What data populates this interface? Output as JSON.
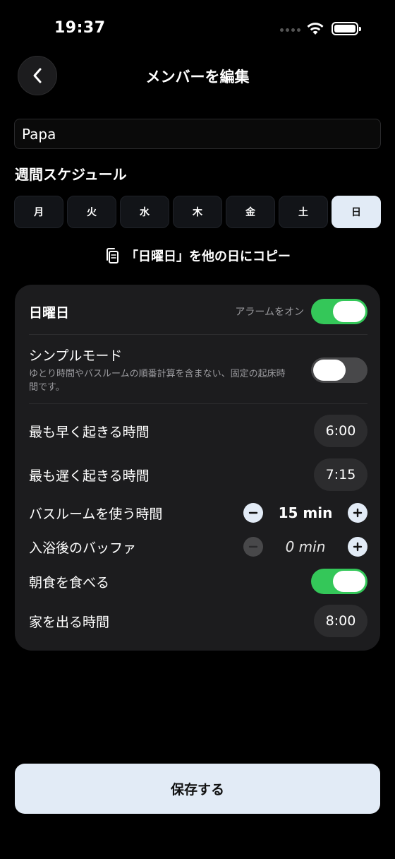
{
  "status": {
    "time": "19:37"
  },
  "nav": {
    "title": "メンバーを編集"
  },
  "member": {
    "name": "Papa"
  },
  "schedule": {
    "title": "週間スケジュール",
    "days": [
      "月",
      "火",
      "水",
      "木",
      "金",
      "土",
      "日"
    ],
    "selected_day": "日"
  },
  "copy": {
    "label": "「日曜日」を他の日にコピー"
  },
  "card": {
    "day_title": "日曜日",
    "alarm_label": "アラームをオン",
    "alarm_on": true,
    "simple_mode": {
      "label": "シンプルモード",
      "description": "ゆとり時間やバスルームの順番計算を含まない、固定の起床時間です。",
      "on": false
    },
    "earliest_wake": {
      "label": "最も早く起きる時間",
      "value": "6:00"
    },
    "latest_wake": {
      "label": "最も遅く起きる時間",
      "value": "7:15"
    },
    "bathroom": {
      "label": "バスルームを使う時間",
      "value": "15 min"
    },
    "buffer": {
      "label": "入浴後のバッファ",
      "value": "0 min"
    },
    "breakfast": {
      "label": "朝食を食べる",
      "on": true
    },
    "leave": {
      "label": "家を出る時間",
      "value": "8:00"
    }
  },
  "save": {
    "label": "保存する"
  },
  "colors": {
    "accent_green": "#34c759",
    "light_button": "#e2ebf6",
    "card_bg": "#1c1c1e"
  }
}
